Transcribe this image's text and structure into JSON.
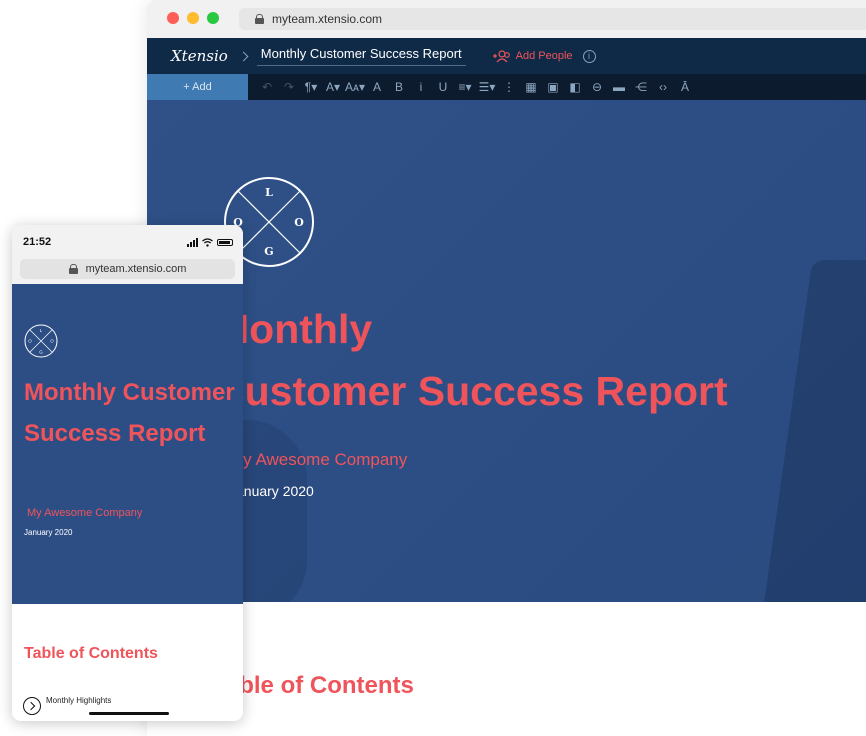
{
  "desktop": {
    "url": "myteam.xtensio.com",
    "brand": "Xtensio",
    "doc_title": "Monthly Customer Success Report",
    "add_people_label": "Add People",
    "info_glyph": "i",
    "add_button_label": "+ Add",
    "toolbar_icons": [
      {
        "name": "undo-icon",
        "glyph": "↶",
        "enabled": false
      },
      {
        "name": "redo-icon",
        "glyph": "↷",
        "enabled": false
      },
      {
        "name": "paragraph-icon",
        "glyph": "¶▾",
        "enabled": true
      },
      {
        "name": "font-icon",
        "glyph": "A▾",
        "enabled": true
      },
      {
        "name": "font-size-icon",
        "glyph": "Aᴀ▾",
        "enabled": true
      },
      {
        "name": "text-color-icon",
        "glyph": "A",
        "enabled": true
      },
      {
        "name": "bold-icon",
        "glyph": "B",
        "enabled": true
      },
      {
        "name": "italic-icon",
        "glyph": "i",
        "enabled": true
      },
      {
        "name": "underline-icon",
        "glyph": "U",
        "enabled": true
      },
      {
        "name": "align-icon",
        "glyph": "≡▾",
        "enabled": true
      },
      {
        "name": "list-icon",
        "glyph": "☰▾",
        "enabled": true
      },
      {
        "name": "more-icon",
        "glyph": "⋮",
        "enabled": true
      },
      {
        "name": "table-icon",
        "glyph": "▦",
        "enabled": true
      },
      {
        "name": "image-icon",
        "glyph": "▣",
        "enabled": true
      },
      {
        "name": "video-icon",
        "glyph": "◧",
        "enabled": true
      },
      {
        "name": "link-icon",
        "glyph": "⊖",
        "enabled": true
      },
      {
        "name": "button-icon",
        "glyph": "▬",
        "enabled": true
      },
      {
        "name": "share-icon",
        "glyph": "⋲",
        "enabled": true
      },
      {
        "name": "code-icon",
        "glyph": "‹›",
        "enabled": true
      },
      {
        "name": "clear-format-icon",
        "glyph": "Ā",
        "enabled": true
      }
    ],
    "hero": {
      "logo_letters": {
        "top": "L",
        "left": "O",
        "right": "O",
        "bottom": "G"
      },
      "title_line1": "Monthly",
      "title_line2": "Customer Success Report",
      "company": "My Awesome Company",
      "date": "January 2020"
    },
    "toc_heading": "Table of Contents"
  },
  "phone": {
    "time": "21:52",
    "url": "myteam.xtensio.com",
    "title": "Monthly Customer Success Report",
    "company": "My Awesome Company",
    "date": "January 2020",
    "toc_heading": "Table of Contents",
    "toc_first_item": "Monthly Highlights"
  },
  "colors": {
    "hero_blue": "#2c4e85",
    "accent_red": "#f0545b",
    "appbar_navy": "#0f2a47",
    "add_button_blue": "#3f7ab2"
  }
}
